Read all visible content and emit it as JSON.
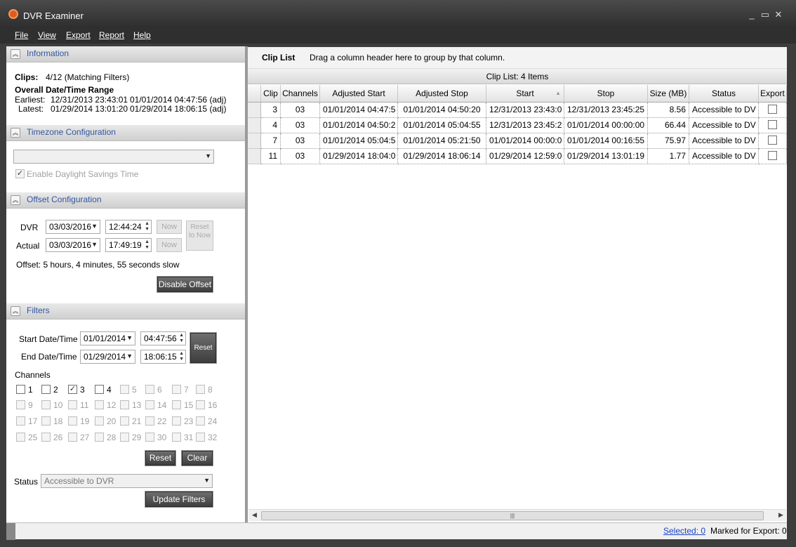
{
  "window": {
    "title": "DVR Examiner",
    "controls": [
      "_",
      "▭",
      "✕"
    ]
  },
  "menu": [
    "File",
    "View",
    "Export",
    "Report",
    "Help"
  ],
  "information": {
    "title": "Information",
    "clips_label": "Clips:",
    "clips_value": "4/12 (Matching Filters)",
    "range_label": "Overall Date/Time Range",
    "earliest_label": "Earliest:",
    "earliest_value": "12/31/2013 23:43:01",
    "earliest_adj": "01/01/2014 04:47:56 (adj)",
    "latest_label": "Latest:",
    "latest_value": "01/29/2014 13:01:20",
    "latest_adj": "01/29/2014 18:06:15 (adj)"
  },
  "timezone": {
    "title": "Timezone Configuration",
    "selected": "",
    "dst_label": "Enable Daylight Savings Time",
    "dst_checked": true
  },
  "offset": {
    "title": "Offset Configuration",
    "dvr_label": "DVR",
    "dvr_date": "03/03/2016",
    "dvr_time": "12:44:24",
    "actual_label": "Actual",
    "actual_date": "03/03/2016",
    "actual_time": "17:49:19",
    "now_label": "Now",
    "reset_now_label": "Reset to Now",
    "offset_text": "Offset: 5 hours, 4 minutes, 55 seconds slow",
    "disable_label": "Disable Offset"
  },
  "filters": {
    "title": "Filters",
    "start_label": "Start Date/Time",
    "start_date": "01/01/2014",
    "start_time": "04:47:56",
    "end_label": "End Date/Time",
    "end_date": "01/29/2014",
    "end_time": "18:06:15",
    "reset_label": "Reset",
    "channels_label": "Channels",
    "channels": [
      {
        "n": "1",
        "enabled": true,
        "checked": false
      },
      {
        "n": "2",
        "enabled": true,
        "checked": false
      },
      {
        "n": "3",
        "enabled": true,
        "checked": true
      },
      {
        "n": "4",
        "enabled": true,
        "checked": false
      },
      {
        "n": "5",
        "enabled": false,
        "checked": false
      },
      {
        "n": "6",
        "enabled": false,
        "checked": false
      },
      {
        "n": "7",
        "enabled": false,
        "checked": false
      },
      {
        "n": "8",
        "enabled": false,
        "checked": false
      },
      {
        "n": "9",
        "enabled": false,
        "checked": false
      },
      {
        "n": "10",
        "enabled": false,
        "checked": false
      },
      {
        "n": "11",
        "enabled": false,
        "checked": false
      },
      {
        "n": "12",
        "enabled": false,
        "checked": false
      },
      {
        "n": "13",
        "enabled": false,
        "checked": false
      },
      {
        "n": "14",
        "enabled": false,
        "checked": false
      },
      {
        "n": "15",
        "enabled": false,
        "checked": false
      },
      {
        "n": "16",
        "enabled": false,
        "checked": false
      },
      {
        "n": "17",
        "enabled": false,
        "checked": false
      },
      {
        "n": "18",
        "enabled": false,
        "checked": false
      },
      {
        "n": "19",
        "enabled": false,
        "checked": false
      },
      {
        "n": "20",
        "enabled": false,
        "checked": false
      },
      {
        "n": "21",
        "enabled": false,
        "checked": false
      },
      {
        "n": "22",
        "enabled": false,
        "checked": false
      },
      {
        "n": "23",
        "enabled": false,
        "checked": false
      },
      {
        "n": "24",
        "enabled": false,
        "checked": false
      },
      {
        "n": "25",
        "enabled": false,
        "checked": false
      },
      {
        "n": "26",
        "enabled": false,
        "checked": false
      },
      {
        "n": "27",
        "enabled": false,
        "checked": false
      },
      {
        "n": "28",
        "enabled": false,
        "checked": false
      },
      {
        "n": "29",
        "enabled": false,
        "checked": false
      },
      {
        "n": "30",
        "enabled": false,
        "checked": false
      },
      {
        "n": "31",
        "enabled": false,
        "checked": false
      },
      {
        "n": "32",
        "enabled": false,
        "checked": false
      }
    ],
    "ch_reset_label": "Reset",
    "ch_clear_label": "Clear",
    "status_label": "Status",
    "status_value": "Accessible to DVR",
    "update_label": "Update Filters"
  },
  "cliplist": {
    "title": "Clip List",
    "hint": "Drag a column header here to group by that column.",
    "count": "Clip List: 4 Items",
    "columns": [
      "Clip",
      "Channels",
      "Adjusted Start",
      "Adjusted Stop",
      "Start",
      "Stop",
      "Size (MB)",
      "Status",
      "Export"
    ],
    "rows": [
      [
        "3",
        "03",
        "01/01/2014 04:47:5",
        "01/01/2014 04:50:20",
        "12/31/2013 23:43:0",
        "12/31/2013 23:45:25",
        "8.56",
        "Accessible to DV"
      ],
      [
        "4",
        "03",
        "01/01/2014 04:50:2",
        "01/01/2014 05:04:55",
        "12/31/2013 23:45:2",
        "01/01/2014 00:00:00",
        "66.44",
        "Accessible to DV"
      ],
      [
        "7",
        "03",
        "01/01/2014 05:04:5",
        "01/01/2014 05:21:50",
        "01/01/2014 00:00:0",
        "01/01/2014 00:16:55",
        "75.97",
        "Accessible to DV"
      ],
      [
        "11",
        "03",
        "01/29/2014 18:04:0",
        "01/29/2014 18:06:14",
        "01/29/2014 12:59:0",
        "01/29/2014 13:01:19",
        "1.77",
        "Accessible to DV"
      ]
    ]
  },
  "status": {
    "selected": "Selected: 0",
    "marked": "Marked for Export: 0"
  }
}
